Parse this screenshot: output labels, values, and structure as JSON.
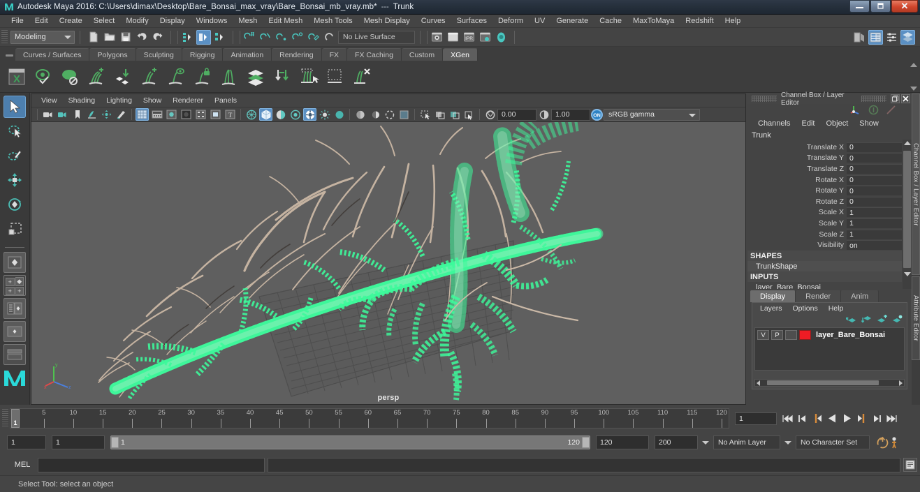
{
  "window": {
    "title": "Autodesk Maya 2016: C:\\Users\\dimax\\Desktop\\Bare_Bonsai_max_vray\\Bare_Bonsai_mb_vray.mb*",
    "separator": "---",
    "selection": "Trunk",
    "app_icon": "maya-logo-icon",
    "minimize": "–",
    "maximize": "❐",
    "close": "✕"
  },
  "menubar": {
    "items": [
      {
        "label": "File"
      },
      {
        "label": "Edit"
      },
      {
        "label": "Create"
      },
      {
        "label": "Select"
      },
      {
        "label": "Modify"
      },
      {
        "label": "Display"
      },
      {
        "label": "Windows"
      },
      {
        "label": "Mesh"
      },
      {
        "label": "Edit Mesh"
      },
      {
        "label": "Mesh Tools"
      },
      {
        "label": "Mesh Display"
      },
      {
        "label": "Curves"
      },
      {
        "label": "Surfaces"
      },
      {
        "label": "Deform"
      },
      {
        "label": "UV"
      },
      {
        "label": "Generate"
      },
      {
        "label": "Cache"
      },
      {
        "label": "MaxToMaya"
      },
      {
        "label": "Redshift"
      },
      {
        "label": "Help"
      }
    ]
  },
  "statusline": {
    "mode": "Modeling",
    "live_surface": "No Live Surface",
    "icons": [
      {
        "name": "new-scene-icon"
      },
      {
        "name": "open-scene-icon"
      },
      {
        "name": "save-scene-icon"
      },
      {
        "name": "undo-icon"
      },
      {
        "name": "redo-icon"
      },
      {
        "name": "select-by-hierarchy-icon"
      },
      {
        "name": "select-by-object-icon"
      },
      {
        "name": "select-by-component-icon"
      },
      {
        "name": "snap-to-grid-icon"
      },
      {
        "name": "snap-to-curve-icon"
      },
      {
        "name": "snap-to-point-icon"
      },
      {
        "name": "snap-to-projected-center-icon"
      },
      {
        "name": "snap-to-view-plane-icon"
      },
      {
        "name": "make-live-icon"
      },
      {
        "name": "render-current-frame-icon"
      },
      {
        "name": "render-sequence-icon"
      },
      {
        "name": "ipr-render-icon"
      },
      {
        "name": "render-settings-icon"
      },
      {
        "name": "hypershade-icon"
      },
      {
        "name": "show-hide-editors-icon"
      },
      {
        "name": "show-hide-channel-box-icon"
      },
      {
        "name": "show-hide-attribute-editor-icon"
      },
      {
        "name": "show-hide-tool-settings-icon"
      }
    ]
  },
  "shelf": {
    "tabs": [
      {
        "label": "Curves / Surfaces",
        "active": false
      },
      {
        "label": "Polygons",
        "active": false
      },
      {
        "label": "Sculpting",
        "active": false
      },
      {
        "label": "Rigging",
        "active": false
      },
      {
        "label": "Animation",
        "active": false
      },
      {
        "label": "Rendering",
        "active": false
      },
      {
        "label": "FX",
        "active": false
      },
      {
        "label": "FX Caching",
        "active": false
      },
      {
        "label": "Custom",
        "active": false
      },
      {
        "label": "XGen",
        "active": true
      }
    ],
    "icons": [
      {
        "name": "xgen-window-icon"
      },
      {
        "name": "xgen-preview-icon"
      },
      {
        "name": "xgen-disable-preview-icon"
      },
      {
        "name": "xgen-add-description-icon"
      },
      {
        "name": "xgen-import-collection-icon"
      },
      {
        "name": "xgen-add-primitive-icon"
      },
      {
        "name": "xgen-visibility-icon"
      },
      {
        "name": "xgen-lock-description-icon"
      },
      {
        "name": "xgen-clumping-icon"
      },
      {
        "name": "xgen-layers-icon"
      },
      {
        "name": "xgen-grooming-icon"
      },
      {
        "name": "xgen-select-guides-icon"
      },
      {
        "name": "xgen-region-select-icon"
      },
      {
        "name": "xgen-delete-guides-icon"
      }
    ]
  },
  "toolbox": {
    "tools": [
      {
        "name": "select-tool",
        "active": true
      },
      {
        "name": "lasso-select-tool",
        "active": false
      },
      {
        "name": "paint-select-tool",
        "active": false
      },
      {
        "name": "move-tool",
        "active": false
      },
      {
        "name": "rotate-tool",
        "active": false
      },
      {
        "name": "scale-tool",
        "active": false
      }
    ],
    "layouts": [
      {
        "name": "single-perspective-layout"
      },
      {
        "name": "four-view-layout"
      },
      {
        "name": "persp-outliner-layout"
      },
      {
        "name": "persp-graph-layout"
      },
      {
        "name": "hypershade-persp-layout"
      }
    ]
  },
  "viewport": {
    "menus": [
      {
        "label": "View"
      },
      {
        "label": "Shading"
      },
      {
        "label": "Lighting"
      },
      {
        "label": "Show"
      },
      {
        "label": "Renderer"
      },
      {
        "label": "Panels"
      }
    ],
    "camera_label": "persp",
    "exposure": "0.00",
    "gamma_value": "1.00",
    "color_management": "sRGB gamma",
    "toolbar_icons": [
      {
        "name": "select-camera-icon"
      },
      {
        "name": "camera-attributes-icon"
      },
      {
        "name": "bookmarks-icon"
      },
      {
        "name": "image-plane-icon"
      },
      {
        "name": "two-d-pan-zoom-icon"
      },
      {
        "name": "grease-pencil-icon"
      },
      {
        "name": "grid-toggle-icon",
        "active": true
      },
      {
        "name": "film-gate-icon"
      },
      {
        "name": "resolution-gate-icon"
      },
      {
        "name": "gate-mask-icon"
      },
      {
        "name": "film-origin-icon"
      },
      {
        "name": "safe-action-icon"
      },
      {
        "name": "safe-title-icon"
      },
      {
        "name": "wireframe-shading-icon"
      },
      {
        "name": "smooth-shade-all-icon",
        "active": true
      },
      {
        "name": "shade-wireframe-icon"
      },
      {
        "name": "use-default-material-icon"
      },
      {
        "name": "shaded-textured-icon",
        "active": true
      },
      {
        "name": "use-all-lights-icon"
      },
      {
        "name": "shadows-icon"
      },
      {
        "name": "screen-space-ao-icon"
      },
      {
        "name": "motion-blur-icon"
      },
      {
        "name": "multisample-aa-icon"
      },
      {
        "name": "depth-of-field-icon"
      },
      {
        "name": "isolate-select-icon"
      },
      {
        "name": "xray-icon"
      },
      {
        "name": "xray-joints-icon"
      },
      {
        "name": "xray-active-components-icon"
      },
      {
        "name": "exposure-icon"
      },
      {
        "name": "gamma-icon"
      },
      {
        "name": "color-management-toggle-icon"
      }
    ]
  },
  "channelbox": {
    "panel_title": "Channel Box / Layer Editor",
    "float_btn": "❐",
    "close_btn": "✕",
    "menus": [
      {
        "label": "Channels"
      },
      {
        "label": "Edit"
      },
      {
        "label": "Object"
      },
      {
        "label": "Show"
      }
    ],
    "object_name": "Trunk",
    "attributes": [
      {
        "label": "Translate X",
        "value": "0"
      },
      {
        "label": "Translate Y",
        "value": "0"
      },
      {
        "label": "Translate Z",
        "value": "0"
      },
      {
        "label": "Rotate X",
        "value": "0"
      },
      {
        "label": "Rotate Y",
        "value": "0"
      },
      {
        "label": "Rotate Z",
        "value": "0"
      },
      {
        "label": "Scale X",
        "value": "1"
      },
      {
        "label": "Scale Y",
        "value": "1"
      },
      {
        "label": "Scale Z",
        "value": "1"
      },
      {
        "label": "Visibility",
        "value": "on"
      }
    ],
    "shapes_header": "SHAPES",
    "shape_name": "TrunkShape",
    "inputs_header": "INPUTS",
    "input_name": "layer_Bare_Bonsai"
  },
  "layereditor": {
    "tabs": [
      {
        "label": "Display",
        "active": true
      },
      {
        "label": "Render",
        "active": false
      },
      {
        "label": "Anim",
        "active": false
      }
    ],
    "menus": [
      {
        "label": "Layers"
      },
      {
        "label": "Options"
      },
      {
        "label": "Help"
      }
    ],
    "icons": [
      {
        "name": "move-layer-up-icon"
      },
      {
        "name": "move-layer-down-icon"
      },
      {
        "name": "new-layer-icon"
      },
      {
        "name": "new-layer-from-selected-icon"
      }
    ],
    "layers": [
      {
        "visible": "V",
        "playback": "P",
        "state": "",
        "color": "#ee1c24",
        "name": "layer_Bare_Bonsai"
      }
    ]
  },
  "vertical_tabs": [
    {
      "label": "Channel Box / Layer Editor"
    },
    {
      "label": "Attribute Editor"
    }
  ],
  "timeslider": {
    "current_frame": "1",
    "ticks": [
      5,
      10,
      15,
      20,
      25,
      30,
      35,
      40,
      45,
      50,
      55,
      60,
      65,
      70,
      75,
      80,
      85,
      90,
      95,
      100,
      105,
      110,
      115,
      120
    ],
    "range_start": 1,
    "range_end": 120,
    "playback_buttons": [
      {
        "name": "go-to-start-icon"
      },
      {
        "name": "step-back-keyframe-icon"
      },
      {
        "name": "step-back-frame-icon"
      },
      {
        "name": "play-backwards-icon"
      },
      {
        "name": "play-forwards-icon"
      },
      {
        "name": "step-forward-frame-icon"
      },
      {
        "name": "step-forward-keyframe-icon"
      },
      {
        "name": "go-to-end-icon"
      }
    ]
  },
  "rangeslider": {
    "anim_start": "1",
    "range_start": "1",
    "bar_start": "1",
    "bar_end": "120",
    "range_end": "120",
    "anim_end": "200",
    "anim_layer": "No Anim Layer",
    "character_set": "No Character Set",
    "auto_key_icon": "auto-keyframe-icon",
    "prefs_icon": "animation-preferences-icon"
  },
  "commandline": {
    "label": "MEL",
    "input_value": "",
    "output_value": "",
    "script_editor_icon": "script-editor-icon"
  },
  "helpline": {
    "text": "Select Tool: select an object"
  },
  "colors": {
    "accent_blue": "#5b90c4",
    "panel_bg": "#444444",
    "viewport_bg": "#5f5f5f",
    "wireframe_green": "#3dfa9b",
    "bark": "#cbb9a7",
    "layer_red": "#ee1c24"
  }
}
